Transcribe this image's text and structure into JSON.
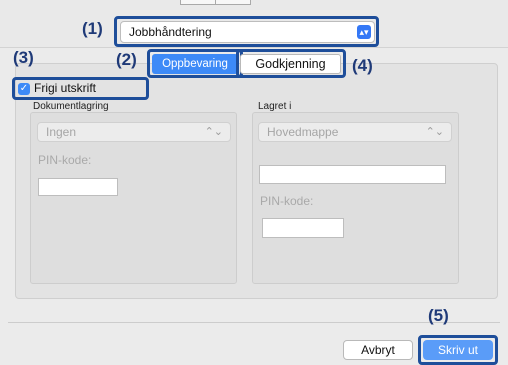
{
  "callouts": {
    "c1": "(1)",
    "c2": "(2)",
    "c3": "(3)",
    "c4": "(4)",
    "c5": "(5)"
  },
  "job_popup": {
    "value": "Jobbhåndtering"
  },
  "tabs": {
    "oppbevaring": "Oppbevaring",
    "godkjenning": "Godkjenning"
  },
  "release_print": {
    "label": "Frigi utskrift",
    "checked": true
  },
  "document_storage": {
    "section_label": "Dokumentlagring",
    "mode_value": "Ingen",
    "pin_label": "PIN-kode:",
    "pin_value": ""
  },
  "stored_in": {
    "section_label": "Lagret i",
    "folder_value": "Hovedmappe",
    "name_value": "",
    "pin_label": "PIN-kode:",
    "pin_value": ""
  },
  "buttons": {
    "cancel": "Avbryt",
    "print": "Skriv ut"
  },
  "colors": {
    "accent": "#3d8af7",
    "highlight": "#1e4e9a",
    "callout_text": "#1f3a78"
  }
}
